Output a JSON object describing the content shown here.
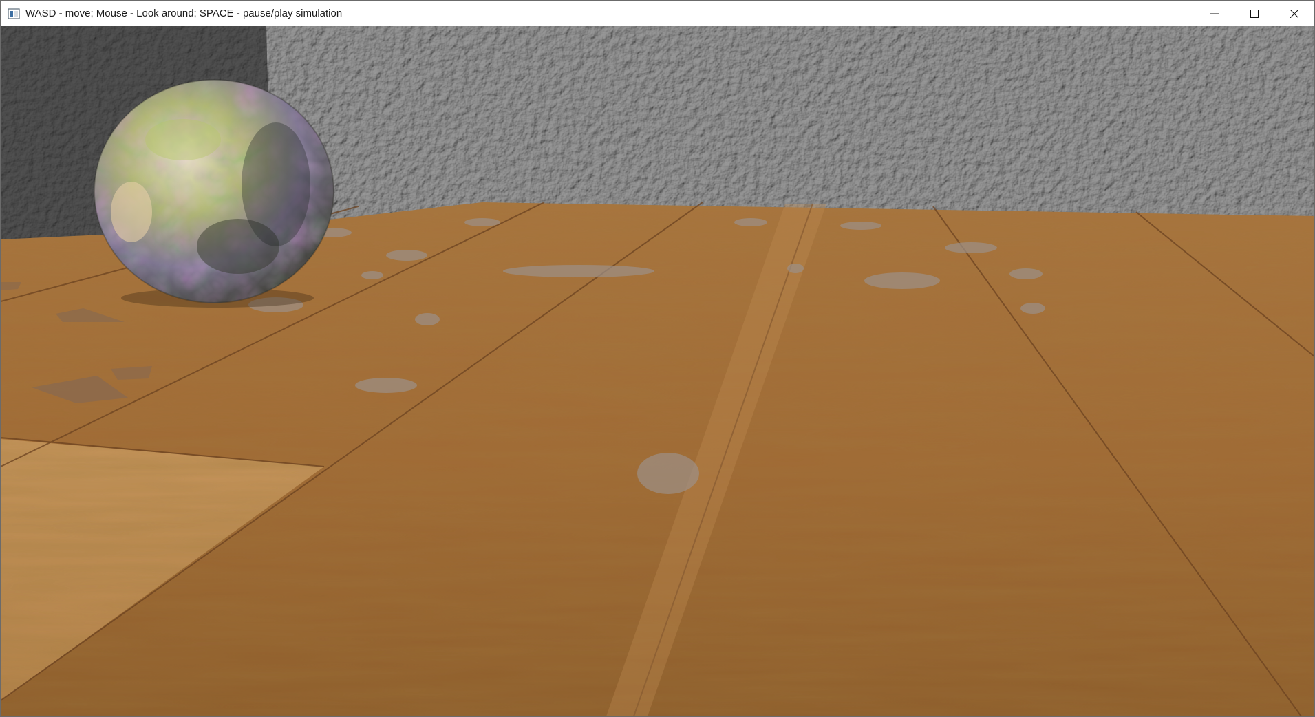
{
  "window": {
    "title": "WASD - move; Mouse - Look around; SPACE - pause/play simulation",
    "icon": "app-window-icon",
    "controls": [
      "minimize-icon",
      "maximize-icon",
      "close-icon"
    ]
  },
  "scene": {
    "objects": [
      "textured-sphere",
      "wooden-floor",
      "stucco-wall",
      "dark-wall"
    ],
    "colors": {
      "wall": "#8e8e8e",
      "dark_wall": "#2c2c2c",
      "floor_light": "#b88550",
      "floor_dark": "#8a5a2a",
      "sphere_green": "#a9b36a",
      "sphere_purple": "#8d7a9c"
    }
  }
}
